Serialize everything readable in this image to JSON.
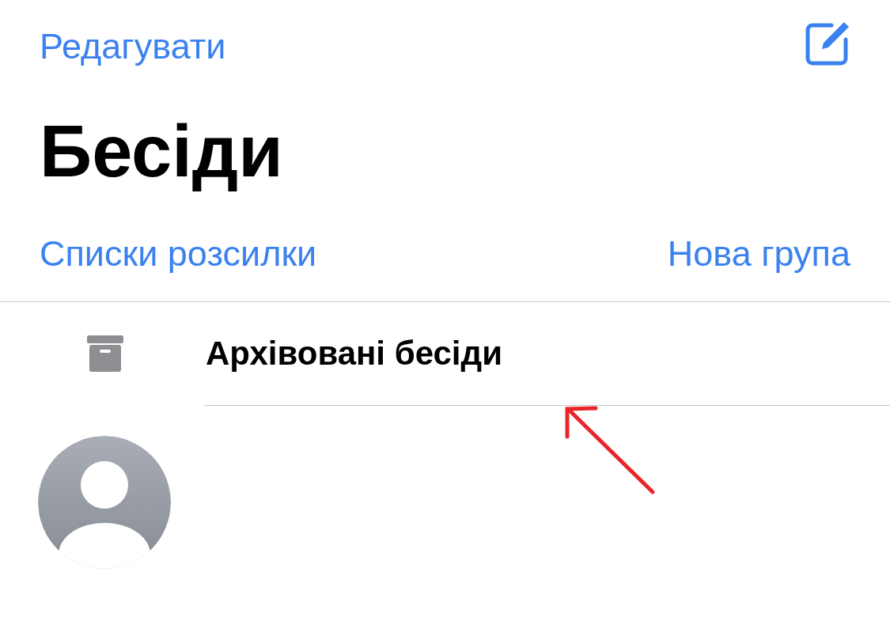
{
  "nav": {
    "edit": "Редагувати"
  },
  "title": "Бесіди",
  "links": {
    "left": "Списки розсилки",
    "right": "Нова група"
  },
  "archived": {
    "label": "Архівовані бесіди"
  }
}
